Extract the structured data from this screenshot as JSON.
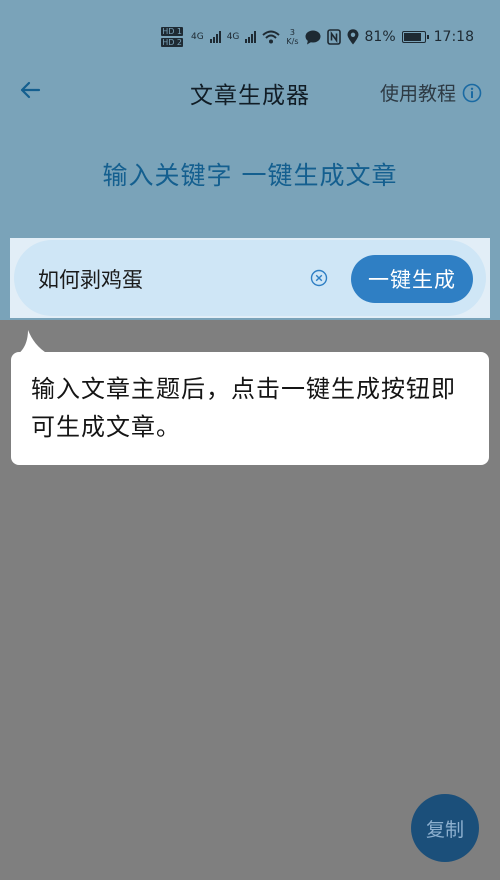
{
  "status_bar": {
    "hd1": "HD 1",
    "hd2": "HD 2",
    "sim1_network": "4G",
    "sim2_network": "4G",
    "net_speed_value": "3",
    "net_speed_unit": "K/s",
    "battery": "81%",
    "time": "17:18",
    "icons": [
      "signal-icon",
      "wifi-icon",
      "message-icon",
      "nfc-icon",
      "location-icon",
      "battery-icon"
    ]
  },
  "header": {
    "title": "文章生成器",
    "tutorial_label": "使用教程",
    "back_icon": "back-arrow-icon",
    "info_icon": "info-icon"
  },
  "subtitle": "输入关键字  一键生成文章",
  "search": {
    "value": "如何剥鸡蛋",
    "placeholder": "",
    "clear_icon": "clear-icon",
    "button_label": "一键生成"
  },
  "tooltip": {
    "text": "输入文章主题后，点击一键生成按钮即可生成文章。"
  },
  "fab": {
    "copy_label": "复制"
  },
  "colors": {
    "accent": "#2f7fc4",
    "overlay": "#7f7f7f",
    "subtitle": "#145f8f"
  }
}
